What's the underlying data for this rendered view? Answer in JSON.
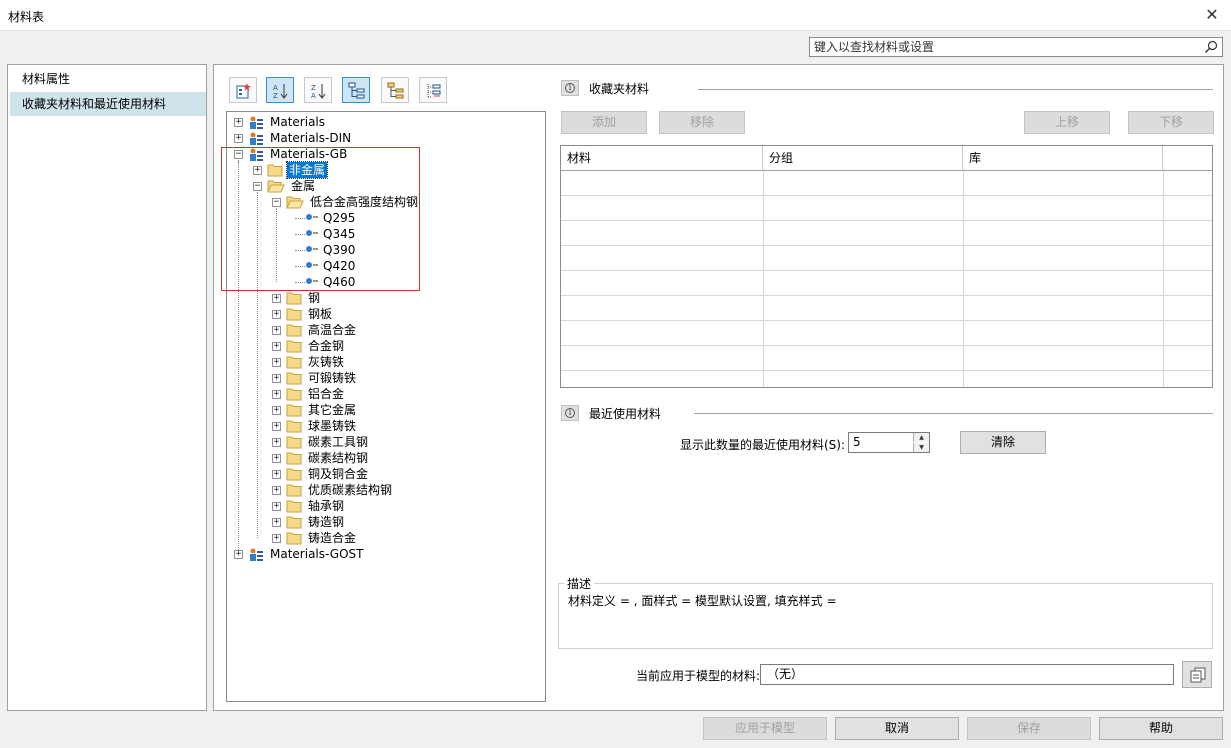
{
  "window": {
    "title": "材料表"
  },
  "search": {
    "placeholder": "键入以查找材料或设置"
  },
  "nav": {
    "items": [
      {
        "label": "材料属性"
      },
      {
        "label": "收藏夹材料和最近使用材料"
      }
    ]
  },
  "tree": {
    "libraries": [
      "Materials",
      "Materials-DIN",
      "Materials-GB",
      "Materials-GOST"
    ],
    "gb_children": [
      "非金属",
      "金属"
    ],
    "metal_children_top": "低合金高强度结构钢",
    "grades": [
      "Q295",
      "Q345",
      "Q390",
      "Q420",
      "Q460"
    ],
    "metal_folders": [
      "钢",
      "钢板",
      "高温合金",
      "合金钢",
      "灰铸铁",
      "可锻铸铁",
      "铝合金",
      "其它金属",
      "球墨铸铁",
      "碳素工具钢",
      "碳素结构钢",
      "铜及铜合金",
      "优质碳素结构钢",
      "轴承钢",
      "铸造钢",
      "铸造合金"
    ]
  },
  "favorites": {
    "title": "收藏夹材料",
    "add": "添加",
    "remove": "移除",
    "up": "上移",
    "down": "下移",
    "columns": [
      "材料",
      "分组",
      "库"
    ]
  },
  "recent": {
    "title": "最近使用材料",
    "count_label": "显示此数量的最近使用材料(S):",
    "count_value": "5",
    "clear": "清除"
  },
  "description": {
    "label": "描述",
    "text": "材料定义 = , 面样式 = 模型默认设置, 填充样式 ="
  },
  "current": {
    "label": "当前应用于模型的材料:",
    "value": "（无）"
  },
  "footer": {
    "apply": "应用于模型",
    "cancel": "取消",
    "save": "保存",
    "help": "帮助"
  },
  "colors": {
    "selection": "#0078d7",
    "nav_selected": "#cfe3ea",
    "highlight_box": "#d03030"
  }
}
